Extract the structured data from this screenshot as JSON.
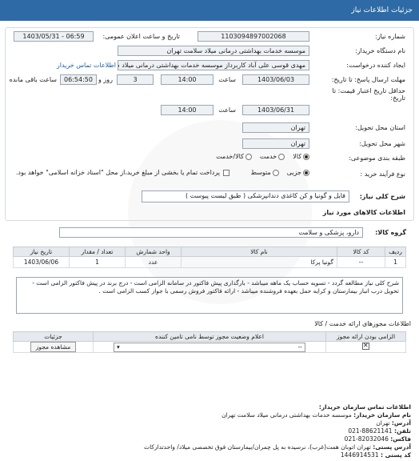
{
  "title": "جزئیات اطلاعات نیاز",
  "form": {
    "need_no_label": "شماره نیاز:",
    "need_no": "1103094897002068",
    "announce_label": "تاریخ و ساعت اعلان عمومی:",
    "announce_value": "1403/05/31 - 06:59",
    "buyer_label": "نام دستگاه خریدار:",
    "buyer_value": "موسسه خدمات بهداشتی درمانی میلاد سلامت تهران",
    "creator_label": "ایجاد کننده درخواست:",
    "creator_value": "مهدی قوسی علی آباد کاربرداز موسسه خدمات بهداشتی درمانی میلاد سلامت",
    "contact_link": "اطلاعات تماس خریدار",
    "reply_label": "مهلت ارسال پاسخ: تا تاریخ:",
    "reply_date": "1403/06/03",
    "time_word": "ساعت",
    "reply_time": "14:00",
    "days_value": "3",
    "days_word": "روز و",
    "remaining_time": "06:54:50",
    "remaining_word": "ساعت باقی مانده",
    "validity_label": "حداقل تاریخ اعتبار قیمت: تا تاریخ:",
    "validity_date": "1403/06/31",
    "validity_time": "14:00",
    "province_label": "استان محل تحویل:",
    "province_value": "تهران",
    "city_label": "شهر محل تحویل:",
    "city_value": "تهران",
    "category_label": "طبقه بندی موضوعی:",
    "category_options": [
      "کالا",
      "خدمت",
      "کالا/خدمت"
    ],
    "category_selected": "کالا",
    "process_label": "نوع فرآیند خرید :",
    "process_options": [
      "جزیی",
      "متوسط"
    ],
    "process_selected": "جزیی",
    "payment_note": "پرداخت تمام یا بخشی از مبلغ خرید،از محل \"اسناد خزانه اسلامی\" خواهد بود."
  },
  "summary": {
    "label": "شرح کلی نیاز:",
    "value": "فایل و گونیا و کن کاغذی دندانپزشکی ( طبق لیست پیوست )"
  },
  "goods": {
    "section_title": "اطلاعات کالاهای مورد نیاز",
    "group_label": "گروه کالا:",
    "group_value": "دارو، پزشکی و سلامت",
    "columns": [
      "ردیف",
      "کد کالا",
      "نام کالا",
      "واحد شمارش",
      "تعداد / مقدار",
      "تاریخ نیاز"
    ],
    "rows": [
      {
        "idx": "1",
        "code": "--",
        "name": "گونیا پرکا",
        "unit": "عدد",
        "qty": "1",
        "date": "1403/06/06"
      }
    ],
    "notes": "شرح کلی نیاز مطالعه گردد - تسویه حساب یک ماهه میباشد - بارگذاری پیش فاکتور در سامانه الزامی است - درج برند در پیش فاکتور الزامی است - تحویل درب انبار بیمارستان و کرایه حمل بعهده فروشنده میباشد - ارائه فاکتور فروش رسمی با جواز کسب الزامی است ."
  },
  "permits": {
    "section_title": "اطلاعات مجوزهای ارائه خدمت / کالا",
    "columns": [
      "الزامی بودن ارائه مجوز",
      "اعلام وضعیت مجوز توسط نامی تامین کننده",
      "جزئیات"
    ],
    "select_value": "--",
    "view_button": "مشاهده مجوز"
  },
  "contact": {
    "title": "اطلاعات تماس سازمان خریدار:",
    "org_label": "نام سازمان خریدار:",
    "org_value": "موسسه خدمات بهداشتی درمانی میلاد سلامت تهران",
    "address_label": "آدرس:",
    "address_value": "تهران",
    "phone_label": "تلفن:",
    "phone_value": "88621141-021",
    "fax_label": "فاکس:",
    "fax_value": "82032046-021",
    "address2_label": "آدرس پستی:",
    "address2_value": "تهران اتوبان همت(غرب)، نرسیده به پل چمران/بیمارستان فوق تخصصی میلاد/ واحدتدارکات",
    "postal_label": "کد پستی :",
    "postal_value": "1446914531"
  },
  "colors": {
    "header": "#2d6aa6",
    "link": "#1f5fa8"
  }
}
